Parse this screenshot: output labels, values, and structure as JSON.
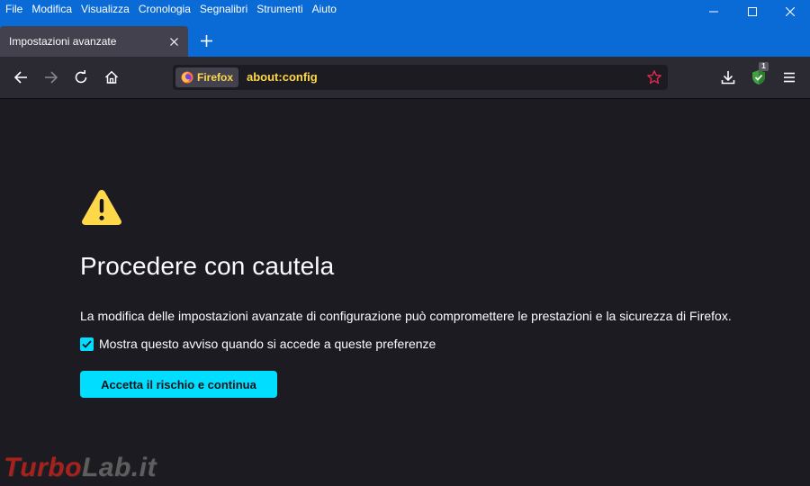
{
  "menu": {
    "items": [
      "File",
      "Modifica",
      "Visualizza",
      "Cronologia",
      "Segnalibri",
      "Strumenti",
      "Aiuto"
    ]
  },
  "tab": {
    "title": "Impostazioni avanzate"
  },
  "urlbar": {
    "identity_label": "Firefox",
    "url": "about:config"
  },
  "toolbar": {
    "extension_badge": "1"
  },
  "warning_page": {
    "heading": "Procedere con cautela",
    "description": "La modifica delle impostazioni avanzate di configurazione può compromettere le prestazioni e la sicurezza di Firefox.",
    "checkbox_label": "Mostra questo avviso quando si accede a queste preferenze",
    "checkbox_checked": true,
    "accept_button_label": "Accetta il rischio e continua"
  },
  "watermark": {
    "part1": "Turbo",
    "part2": "Lab.it"
  },
  "colors": {
    "titlebar": "#0a6ad6",
    "tab_active": "#42414d",
    "toolbar": "#2b2a33",
    "page_bg": "#1c1b22",
    "accent": "#00ddff",
    "url_text": "#ffd84a",
    "warning": "#ffd84a"
  }
}
